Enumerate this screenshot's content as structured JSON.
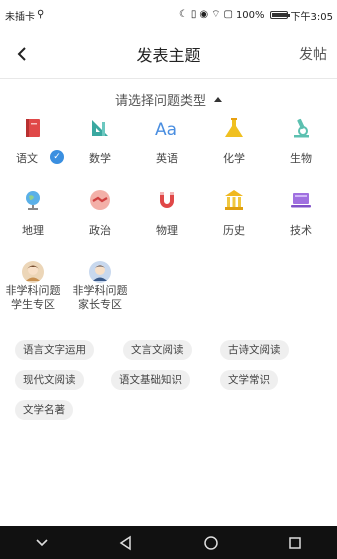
{
  "status": {
    "carrier": "未插卡",
    "battery": "100%",
    "time": "下午3:05",
    "battery_level": 1.0
  },
  "nav": {
    "title": "发表主题",
    "post_label": "发帖"
  },
  "picker": {
    "label": "请选择问题类型"
  },
  "subjects": [
    {
      "label": "语文",
      "icon": "book-icon",
      "selected": true
    },
    {
      "label": "数学",
      "icon": "ruler-triangle-icon",
      "selected": false
    },
    {
      "label": "英语",
      "icon": "letters-aa-icon",
      "selected": false
    },
    {
      "label": "化学",
      "icon": "flask-icon",
      "selected": false
    },
    {
      "label": "生物",
      "icon": "microscope-icon",
      "selected": false
    },
    {
      "label": "地理",
      "icon": "globe-icon",
      "selected": false
    },
    {
      "label": "政治",
      "icon": "handshake-icon",
      "selected": false
    },
    {
      "label": "物理",
      "icon": "magnet-icon",
      "selected": false
    },
    {
      "label": "历史",
      "icon": "landmark-icon",
      "selected": false
    },
    {
      "label": "技术",
      "icon": "laptop-icon",
      "selected": false
    },
    {
      "label": "非学科问题学生专区",
      "line1": "非学科问题",
      "line2": "学生专区",
      "icon": "student-avatar-icon",
      "selected": false
    },
    {
      "label": "非学科问题家长专区",
      "line1": "非学科问题",
      "line2": "家长专区",
      "icon": "parent-avatar-icon",
      "selected": false
    }
  ],
  "tags": [
    "语言文字运用",
    "文言文阅读",
    "古诗文阅读",
    "现代文阅读",
    "语文基础知识",
    "文学常识",
    "文学名著"
  ],
  "colors": {
    "accent": "#3a8fe0",
    "chinese": "#e04848",
    "math": "#3aa8a0",
    "english": "#4a8ee0",
    "chem": "#f0c020",
    "bio": "#5cc0b0"
  }
}
